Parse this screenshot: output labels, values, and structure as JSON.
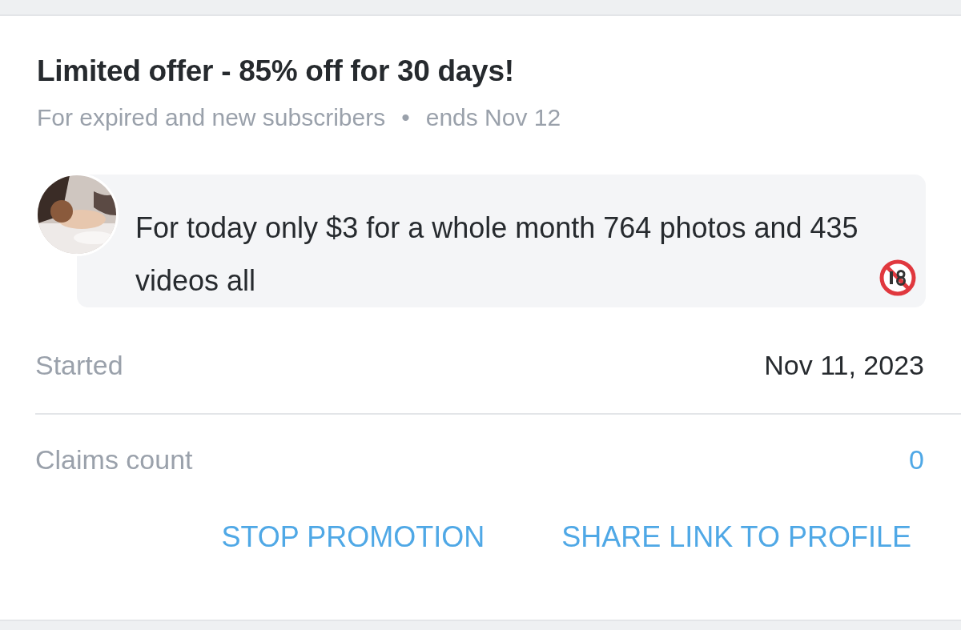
{
  "promotion": {
    "title": "Limited offer - 85% off for 30 days!",
    "audience": "For expired and new subscribers",
    "separator": "•",
    "ends": "ends Nov 12",
    "message": "For today only $3 for a whole month 764 photos and 435 videos all",
    "details": [
      {
        "label": "Started",
        "value": "Nov 11, 2023",
        "kind": "plain"
      },
      {
        "label": "Claims count",
        "value": "0",
        "kind": "link"
      }
    ],
    "actions": [
      "STOP PROMOTION",
      "SHARE LINK TO PROFILE"
    ]
  }
}
